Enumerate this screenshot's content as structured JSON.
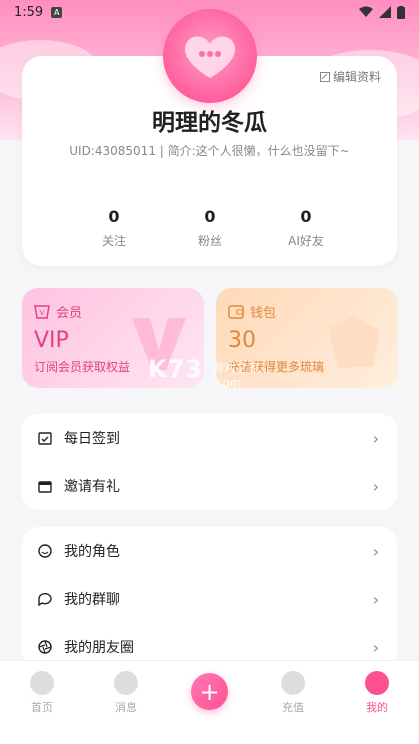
{
  "status_bar": {
    "time": "1:59",
    "a_badge": "A"
  },
  "profile": {
    "edit_label": "编辑资料",
    "username": "明理的冬瓜",
    "bio": "UID:43085011 | 简介:这个人很懒，什么也没留下~",
    "stats": [
      {
        "value": "0",
        "label": "关注"
      },
      {
        "value": "0",
        "label": "粉丝"
      },
      {
        "value": "0",
        "label": "AI好友"
      }
    ]
  },
  "promos": {
    "vip": {
      "title": "会员",
      "big": "VIP",
      "sub": "订阅会员获取权益"
    },
    "wallet": {
      "title": "钱包",
      "big": "30",
      "sub": "充值获得更多琉璃"
    }
  },
  "watermark": {
    "main": "K73",
    "sub": "游戏之家",
    "domain": ".com"
  },
  "menu_group_1": [
    {
      "label": "每日签到",
      "icon": "calendar-check-icon"
    },
    {
      "label": "邀请有礼",
      "icon": "gift-calendar-icon"
    }
  ],
  "menu_group_2": [
    {
      "label": "我的角色",
      "icon": "smile-icon"
    },
    {
      "label": "我的群聊",
      "icon": "chat-icon"
    },
    {
      "label": "我的朋友圈",
      "icon": "aperture-icon"
    }
  ],
  "tabbar": {
    "items": [
      {
        "label": "首页"
      },
      {
        "label": "消息"
      },
      {
        "label": "充值"
      },
      {
        "label": "我的"
      }
    ],
    "plus": "+"
  },
  "colors": {
    "accent": "#ff4f93",
    "vip": "#e0437f",
    "wallet": "#e0883a"
  }
}
